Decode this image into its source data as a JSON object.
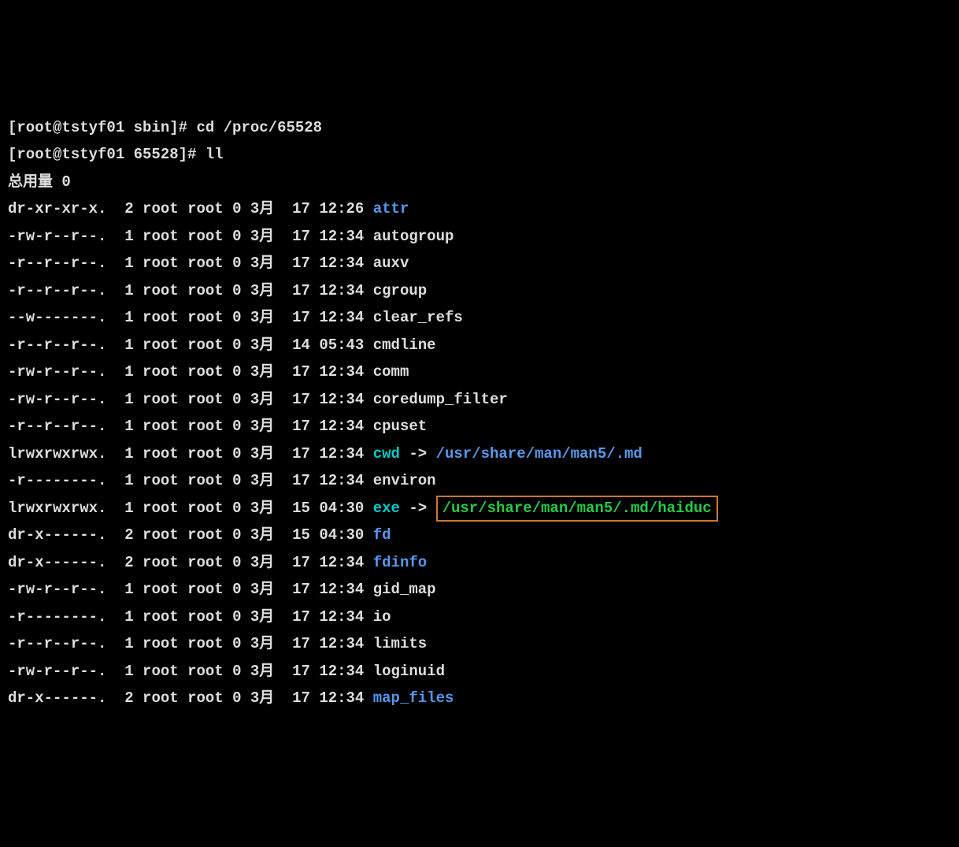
{
  "prompts": [
    {
      "user": "root",
      "host": "tstyf01",
      "dir": "sbin",
      "cmd": "cd /proc/65528"
    },
    {
      "user": "root",
      "host": "tstyf01",
      "dir": "65528",
      "cmd": "ll"
    }
  ],
  "total_label": "总用量 0",
  "rows": [
    {
      "perm": "dr-xr-xr-x.",
      "n": "2",
      "own": "root",
      "grp": "root",
      "sz": "0",
      "mon": "3月",
      "day": "17",
      "time": "12:26",
      "name": "attr",
      "type": "dir"
    },
    {
      "perm": "-rw-r--r--.",
      "n": "1",
      "own": "root",
      "grp": "root",
      "sz": "0",
      "mon": "3月",
      "day": "17",
      "time": "12:34",
      "name": "autogroup",
      "type": "file"
    },
    {
      "perm": "-r--r--r--.",
      "n": "1",
      "own": "root",
      "grp": "root",
      "sz": "0",
      "mon": "3月",
      "day": "17",
      "time": "12:34",
      "name": "auxv",
      "type": "file"
    },
    {
      "perm": "-r--r--r--.",
      "n": "1",
      "own": "root",
      "grp": "root",
      "sz": "0",
      "mon": "3月",
      "day": "17",
      "time": "12:34",
      "name": "cgroup",
      "type": "file"
    },
    {
      "perm": "--w-------.",
      "n": "1",
      "own": "root",
      "grp": "root",
      "sz": "0",
      "mon": "3月",
      "day": "17",
      "time": "12:34",
      "name": "clear_refs",
      "type": "file"
    },
    {
      "perm": "-r--r--r--.",
      "n": "1",
      "own": "root",
      "grp": "root",
      "sz": "0",
      "mon": "3月",
      "day": "14",
      "time": "05:43",
      "name": "cmdline",
      "type": "file"
    },
    {
      "perm": "-rw-r--r--.",
      "n": "1",
      "own": "root",
      "grp": "root",
      "sz": "0",
      "mon": "3月",
      "day": "17",
      "time": "12:34",
      "name": "comm",
      "type": "file"
    },
    {
      "perm": "-rw-r--r--.",
      "n": "1",
      "own": "root",
      "grp": "root",
      "sz": "0",
      "mon": "3月",
      "day": "17",
      "time": "12:34",
      "name": "coredump_filter",
      "type": "file"
    },
    {
      "perm": "-r--r--r--.",
      "n": "1",
      "own": "root",
      "grp": "root",
      "sz": "0",
      "mon": "3月",
      "day": "17",
      "time": "12:34",
      "name": "cpuset",
      "type": "file"
    },
    {
      "perm": "lrwxrwxrwx.",
      "n": "1",
      "own": "root",
      "grp": "root",
      "sz": "0",
      "mon": "3月",
      "day": "17",
      "time": "12:34",
      "name": "cwd",
      "type": "link",
      "arrow": "->",
      "target": "/usr/share/man/man5/.md"
    },
    {
      "perm": "-r--------.",
      "n": "1",
      "own": "root",
      "grp": "root",
      "sz": "0",
      "mon": "3月",
      "day": "17",
      "time": "12:34",
      "name": "environ",
      "type": "file"
    },
    {
      "perm": "lrwxrwxrwx.",
      "n": "1",
      "own": "root",
      "grp": "root",
      "sz": "0",
      "mon": "3月",
      "day": "15",
      "time": "04:30",
      "name": "exe",
      "type": "link",
      "arrow": "->",
      "target": "/usr/share/man/man5/.md/haiduc",
      "highlight": true
    },
    {
      "perm": "dr-x------.",
      "n": "2",
      "own": "root",
      "grp": "root",
      "sz": "0",
      "mon": "3月",
      "day": "15",
      "time": "04:30",
      "name": "fd",
      "type": "dir"
    },
    {
      "perm": "dr-x------.",
      "n": "2",
      "own": "root",
      "grp": "root",
      "sz": "0",
      "mon": "3月",
      "day": "17",
      "time": "12:34",
      "name": "fdinfo",
      "type": "dir"
    },
    {
      "perm": "-rw-r--r--.",
      "n": "1",
      "own": "root",
      "grp": "root",
      "sz": "0",
      "mon": "3月",
      "day": "17",
      "time": "12:34",
      "name": "gid_map",
      "type": "file"
    },
    {
      "perm": "-r--------.",
      "n": "1",
      "own": "root",
      "grp": "root",
      "sz": "0",
      "mon": "3月",
      "day": "17",
      "time": "12:34",
      "name": "io",
      "type": "file"
    },
    {
      "perm": "-r--r--r--.",
      "n": "1",
      "own": "root",
      "grp": "root",
      "sz": "0",
      "mon": "3月",
      "day": "17",
      "time": "12:34",
      "name": "limits",
      "type": "file"
    },
    {
      "perm": "-rw-r--r--.",
      "n": "1",
      "own": "root",
      "grp": "root",
      "sz": "0",
      "mon": "3月",
      "day": "17",
      "time": "12:34",
      "name": "loginuid",
      "type": "file"
    },
    {
      "perm": "dr-x------.",
      "n": "2",
      "own": "root",
      "grp": "root",
      "sz": "0",
      "mon": "3月",
      "day": "17",
      "time": "12:34",
      "name": "map_files",
      "type": "dir"
    }
  ]
}
